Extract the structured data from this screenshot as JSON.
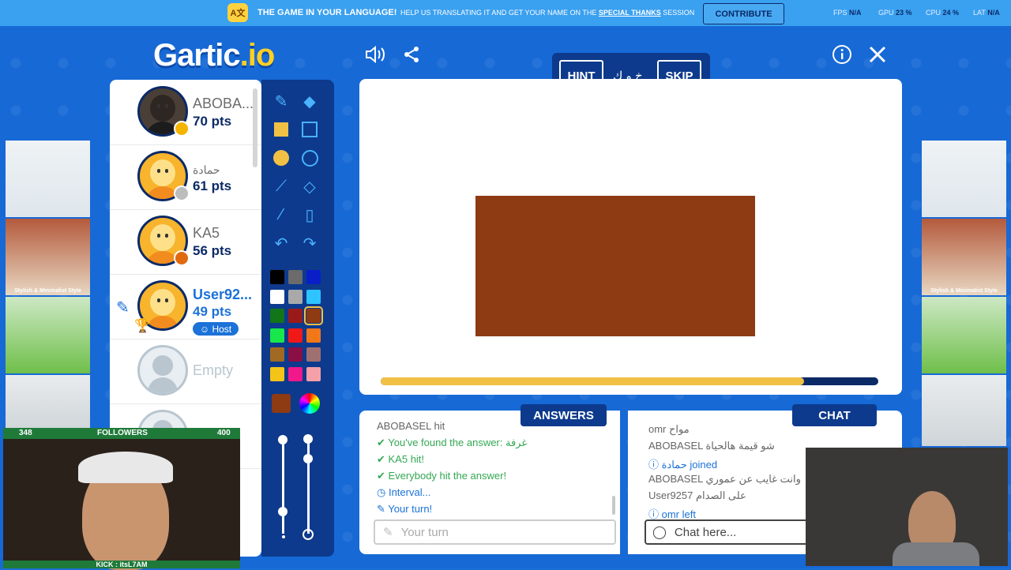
{
  "banner": {
    "headline": "THE GAME IN YOUR LANGUAGE!",
    "text_pre": "HELP US TRANSLATING IT AND GET YOUR NAME ON THE",
    "text_link": "SPECIAL THANKS",
    "text_post": "SESSION",
    "contribute_label": "CONTRIBUTE",
    "fps_label": "FPS",
    "fps_value": "N/A",
    "gpu_label": "GPU",
    "gpu_value": "23 %",
    "cpu_label": "CPU",
    "cpu_value": "24 %",
    "lat_label": "LAT",
    "lat_value": "N/A"
  },
  "logo": {
    "main": "Gartic",
    "suffix": ".io"
  },
  "players": [
    {
      "name": "ABOBA...",
      "points": "70 pts",
      "status_color": "#f5b400"
    },
    {
      "name": "حمادة",
      "points": "61 pts",
      "status_color": "#bdbdbd"
    },
    {
      "name": "KA5",
      "points": "56 pts",
      "status_color": "#e06a10"
    },
    {
      "name": "User92...",
      "points": "49 pts",
      "host_label": "Host",
      "status_color": "#1b72d8"
    },
    {
      "name": "Empty"
    }
  ],
  "hint": {
    "hint_label": "HINT",
    "word": "خ و ك",
    "skip_label": "SKIP"
  },
  "palette": [
    "#000000",
    "#6b6b6b",
    "#0a1ec8",
    "#ffffff",
    "#a9a9a9",
    "#2ec4ff",
    "#11751a",
    "#9a1a1a",
    "#8e3a12",
    "#19e64b",
    "#f01818",
    "#f07818",
    "#a06a22",
    "#8a0f45",
    "#a07070",
    "#f5c418",
    "#f0188a",
    "#f5a0a8"
  ],
  "selected_color": "#8e3a12",
  "canvas": {
    "shape_color": "#8e3a12",
    "timer_progress": 0.85
  },
  "answers": {
    "tab_label": "ANSWERS",
    "messages": [
      {
        "text": "ABOBASEL hit",
        "type": "gray"
      },
      {
        "text": "You've found the answer: غرفة",
        "type": "green"
      },
      {
        "text": "KA5 hit!",
        "type": "green"
      },
      {
        "text": "Everybody hit the answer!",
        "type": "green"
      },
      {
        "text": "Interval...",
        "type": "blue"
      },
      {
        "text": "Your turn!",
        "type": "blue"
      }
    ],
    "input_placeholder": "Your turn"
  },
  "chat": {
    "tab_label": "CHAT",
    "messages": [
      {
        "text": "omr مواح",
        "type": "gray"
      },
      {
        "text": "ABOBASEL شو قيمة هالحياة",
        "type": "gray"
      },
      {
        "text": "حمادة joined",
        "type": "blue"
      },
      {
        "text": "ABOBASEL وانت غايب عن عموري",
        "type": "gray"
      },
      {
        "text": "User9257 على الصدام",
        "type": "gray"
      },
      {
        "text": "omr left",
        "type": "blue"
      }
    ],
    "input_placeholder": "Chat here..."
  },
  "stream": {
    "followers_label": "FOLLOWERS",
    "followers_current": "348",
    "followers_goal": "400",
    "footer_text": "KICK : itsL7AM"
  },
  "ads": {
    "caption": "Stylish & Minimalist Style"
  }
}
